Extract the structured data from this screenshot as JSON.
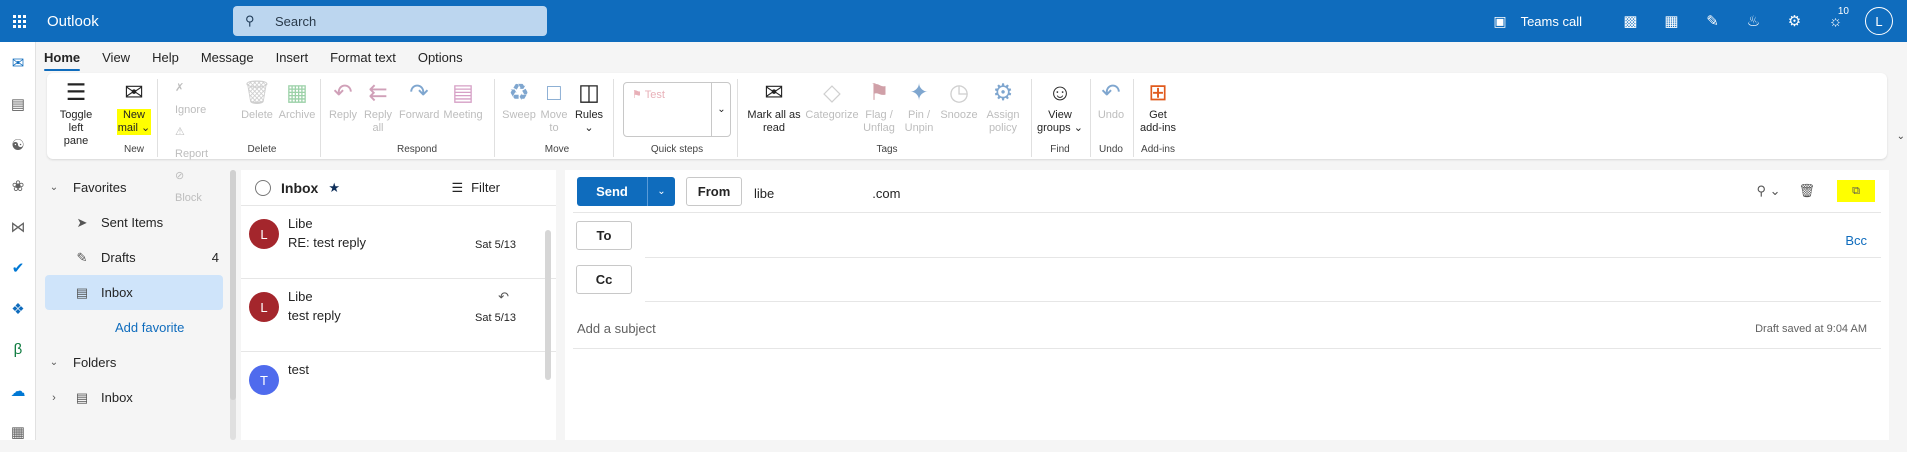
{
  "topbar": {
    "app_title": "Outlook",
    "search_placeholder": "Search",
    "teams_call": "Teams call",
    "notification_badge": "10",
    "avatar_initial": "L",
    "colors": {
      "brand": "#0f6cbd"
    }
  },
  "tabs": [
    "Home",
    "View",
    "Help",
    "Message",
    "Insert",
    "Format text",
    "Options"
  ],
  "ribbon": {
    "toggle_left_pane": [
      "Toggle left",
      "pane"
    ],
    "new_mail": [
      "New",
      "mail"
    ],
    "group_new": "New",
    "ignore": "Ignore",
    "report": "Report",
    "block": "Block",
    "delete": "Delete",
    "archive": "Archive",
    "group_delete": "Delete",
    "reply": "Reply",
    "reply_all": [
      "Reply",
      "all"
    ],
    "forward": "Forward",
    "meeting": "Meeting",
    "group_respond": "Respond",
    "sweep": "Sweep",
    "move_to": [
      "Move",
      "to"
    ],
    "rules": "Rules",
    "group_move": "Move",
    "quick_steps_item": "Test",
    "group_quick_steps": "Quick steps",
    "mark_all_read": [
      "Mark all as",
      "read"
    ],
    "categorize": "Categorize",
    "flag_unflag": [
      "Flag /",
      "Unflag"
    ],
    "pin_unpin": [
      "Pin /",
      "Unpin"
    ],
    "snooze": "Snooze",
    "assign_policy": [
      "Assign",
      "policy"
    ],
    "group_tags": "Tags",
    "view_groups": [
      "View",
      "groups"
    ],
    "group_find": "Find",
    "undo": "Undo",
    "group_undo": "Undo",
    "get_addins": [
      "Get",
      "add-ins"
    ],
    "group_addins": "Add-ins"
  },
  "nav": {
    "favorites": "Favorites",
    "sent_items": "Sent Items",
    "drafts": "Drafts",
    "drafts_count": "4",
    "inbox": "Inbox",
    "add_favorite": "Add favorite",
    "folders": "Folders",
    "folders_inbox": "Inbox"
  },
  "maillist": {
    "title": "Inbox",
    "filter": "Filter",
    "items": [
      {
        "initial": "L",
        "from": "Libe",
        "subject": "RE: test reply",
        "date": "Sat 5/13",
        "color": "#a4262c"
      },
      {
        "initial": "L",
        "from": "Libe",
        "subject": "test reply",
        "date": "Sat 5/13",
        "color": "#a4262c"
      },
      {
        "initial": "T",
        "from": "test",
        "subject": "",
        "date": "",
        "color": "#4f6bed"
      }
    ]
  },
  "compose": {
    "send": "Send",
    "from_label": "From",
    "from_value_start": "libe",
    "from_value_end": ".com",
    "to_label": "To",
    "cc_label": "Cc",
    "bcc": "Bcc",
    "subject_placeholder": "Add a subject",
    "draft_status": "Draft saved at 9:04 AM"
  }
}
